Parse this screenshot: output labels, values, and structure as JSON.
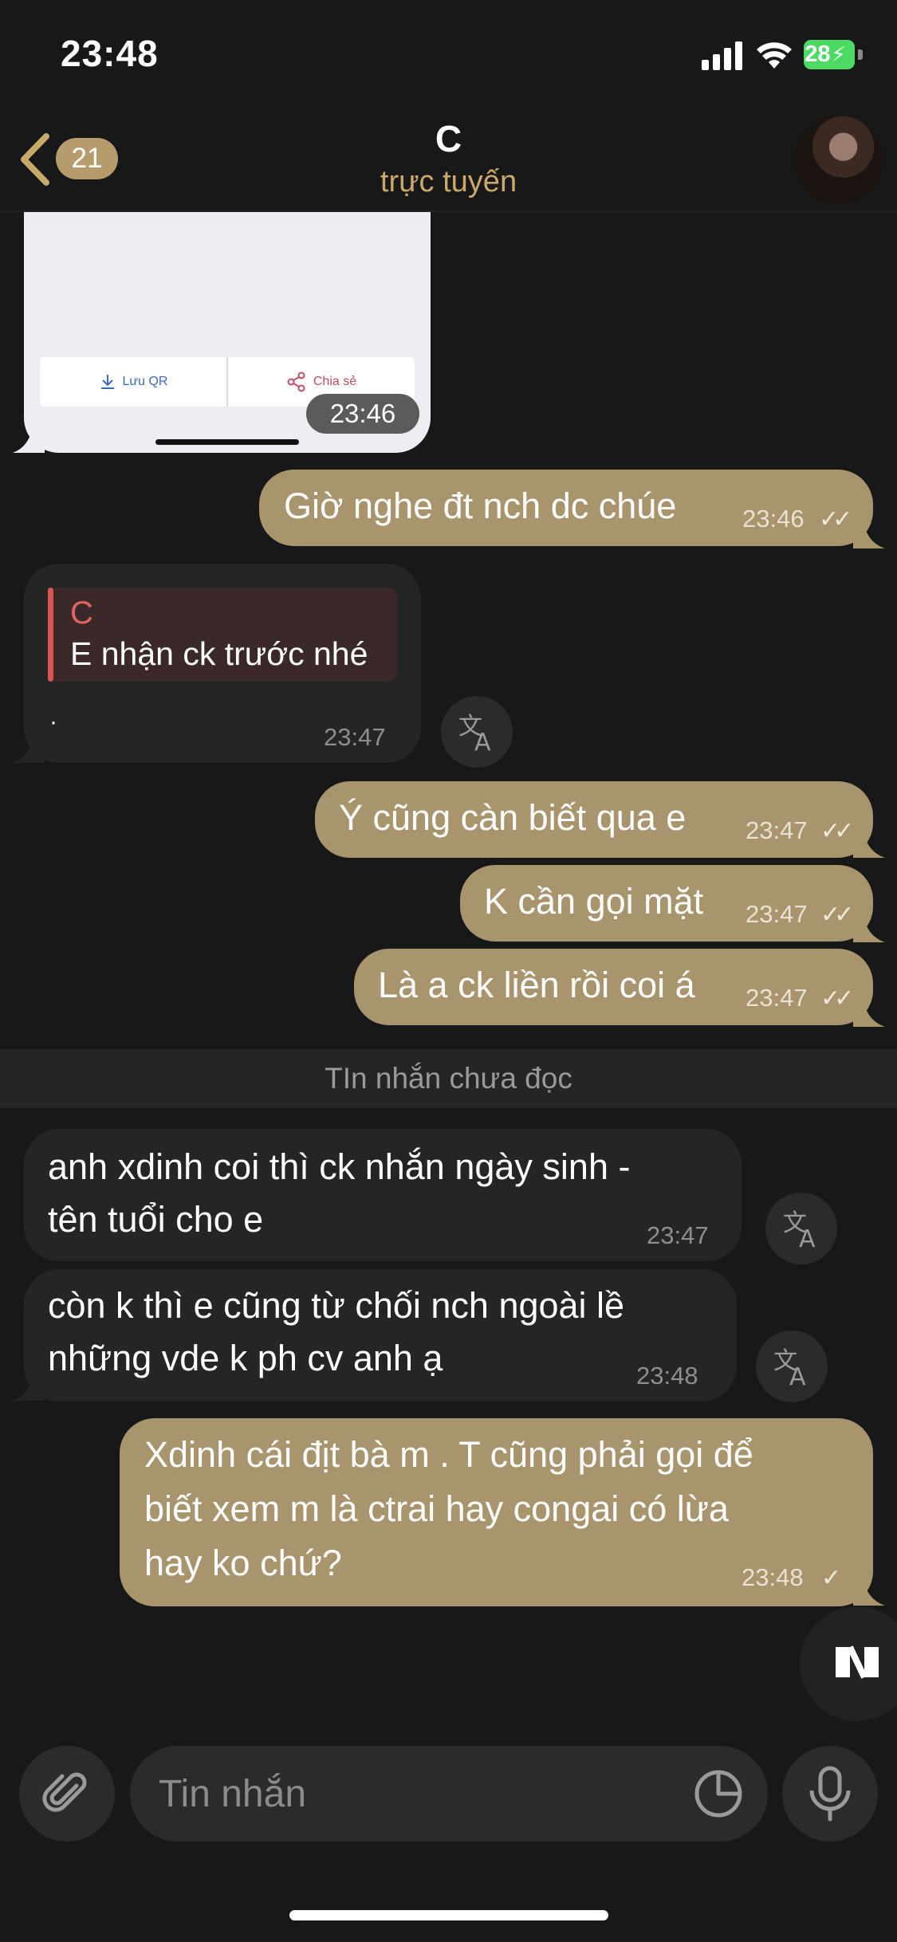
{
  "status_bar": {
    "time": "23:48",
    "battery": "28"
  },
  "header": {
    "back_count": "21",
    "title": "C",
    "status": "trực tuyến"
  },
  "image_message": {
    "save_label": "Lưu QR",
    "share_label": "Chia sẻ",
    "time": "23:46"
  },
  "messages": [
    {
      "text": "Giờ nghe đt nch dc chúe",
      "time": "23:46"
    },
    {
      "reply_name": "C",
      "reply_text": "E nhận ck trước nhé",
      "text": "·",
      "time": "23:47"
    },
    {
      "text": "Ý cũng càn biết qua e",
      "time": "23:47"
    },
    {
      "text": "K cần gọi mặt",
      "time": "23:47"
    },
    {
      "text": "Là a ck liền rồi coi á",
      "time": "23:47"
    },
    {
      "line1": "anh xdinh coi thì ck nhắn ngày sinh -",
      "line2": "tên tuổi cho e",
      "time": "23:47"
    },
    {
      "line1": "còn k thì e cũng từ chối nch ngoài lề",
      "line2": "những vde k ph cv anh ạ",
      "time": "23:48"
    },
    {
      "line1": "Xdinh cái địt bà m . T cũng phải gọi để",
      "line2": "biết xem m là ctrai hay congai có lừa",
      "line3": "hay ko chứ?",
      "time": "23:48"
    }
  ],
  "unread_divider": "TIn nhắn chưa đọc",
  "composer": {
    "placeholder": "Tin nhắn"
  },
  "colors": {
    "accent": "#c9a96a",
    "outgoing_bubble": "#a8946d",
    "incoming_bubble": "#252525",
    "background": "#181818"
  },
  "icons": [
    "back-chevron-icon",
    "translate-icon",
    "attach-icon",
    "sticker-icon",
    "mic-icon",
    "app-logo-icon",
    "download-icon",
    "share-icon",
    "double-check-icon",
    "check-icon"
  ]
}
